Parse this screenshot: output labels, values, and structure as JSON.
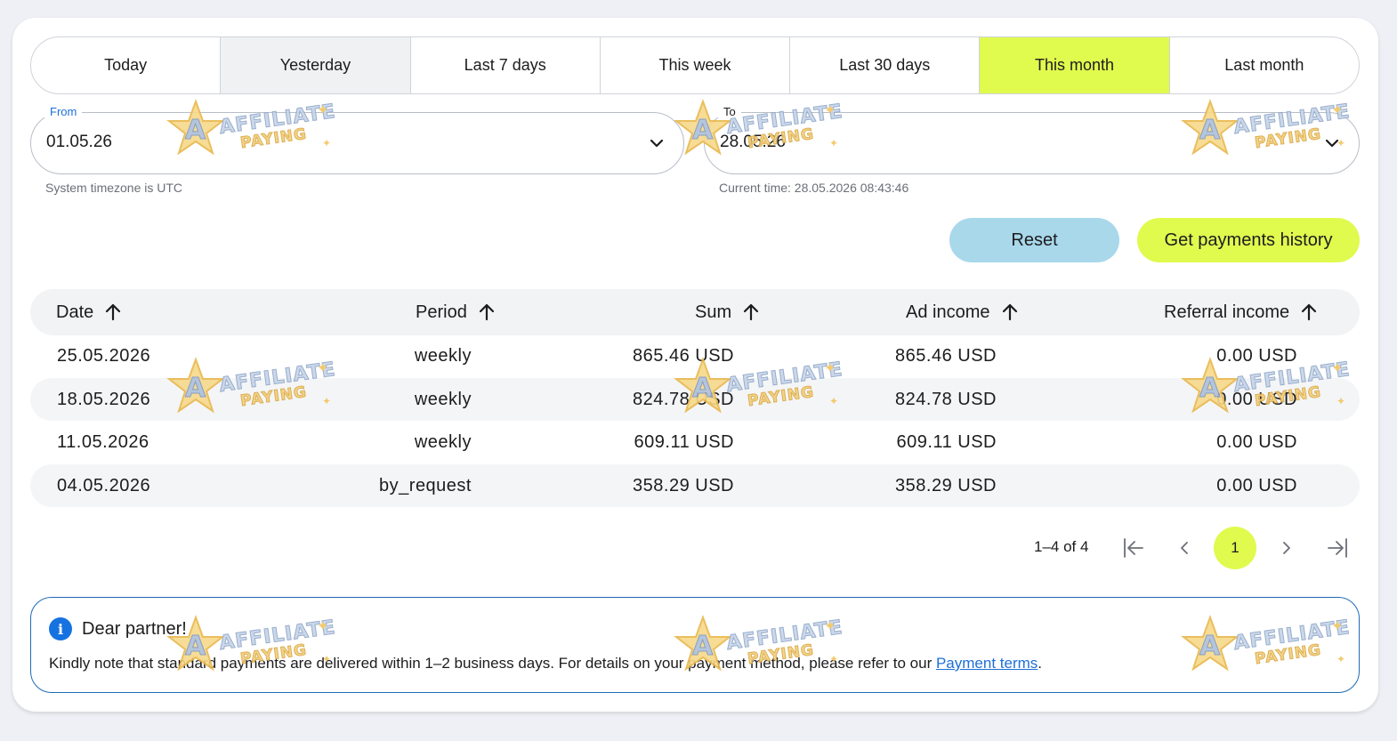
{
  "periods": [
    {
      "label": "Today"
    },
    {
      "label": "Yesterday"
    },
    {
      "label": "Last 7 days"
    },
    {
      "label": "This week"
    },
    {
      "label": "Last 30 days"
    },
    {
      "label": "This month",
      "active": true
    },
    {
      "label": "Last month"
    }
  ],
  "from": {
    "label": "From",
    "value": "01.05.26",
    "hint": "System timezone is UTC"
  },
  "to": {
    "label": "To",
    "value": "28.05.26",
    "hint": "Current time: 28.05.2026 08:43:46"
  },
  "buttons": {
    "reset": "Reset",
    "get_history": "Get payments history"
  },
  "table": {
    "columns": [
      "Date",
      "Period",
      "Sum",
      "Ad income",
      "Referral income"
    ],
    "rows": [
      [
        "25.05.2026",
        "weekly",
        "865.46 USD",
        "865.46 USD",
        "0.00 USD"
      ],
      [
        "18.05.2026",
        "weekly",
        "824.78 USD",
        "824.78 USD",
        "0.00 USD"
      ],
      [
        "11.05.2026",
        "weekly",
        "609.11 USD",
        "609.11 USD",
        "0.00 USD"
      ],
      [
        "04.05.2026",
        "by_request",
        "358.29 USD",
        "358.29 USD",
        "0.00 USD"
      ]
    ]
  },
  "pagination": {
    "info": "1–4 of 4",
    "current_page": "1"
  },
  "notice": {
    "title": "Dear partner!",
    "text": "Kindly note that standard payments are delivered within 1–2 business days. For details on your payment method, please refer to our ",
    "link": "Payment terms",
    "suffix": "."
  },
  "watermark": {
    "line1": "AFFILIATE",
    "line2": "PAYING"
  },
  "colors": {
    "accent": "#e0fa4e",
    "reset": "#a9d8eb",
    "link": "#1d6fd9",
    "notice_border": "#1e6bb5"
  },
  "icons": {
    "sort": "arrow-up-icon",
    "dropdown": "chevron-down-icon",
    "info": "info-icon"
  }
}
